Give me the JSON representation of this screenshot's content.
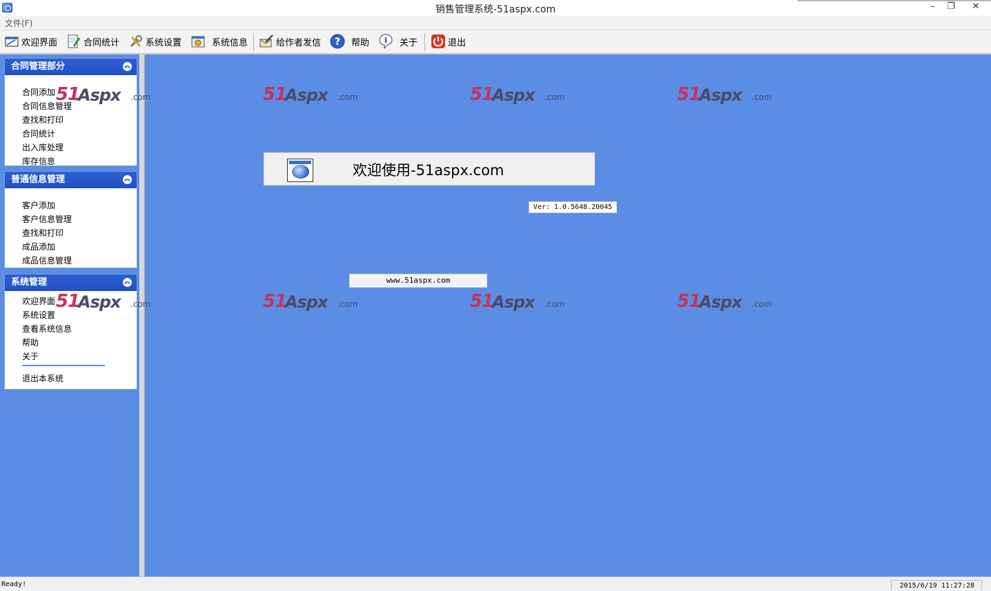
{
  "window": {
    "title": "销售管理系统-51aspx.com",
    "minimize": "–",
    "restore": "❐",
    "close": "✕"
  },
  "menu": {
    "file": "文件(F)"
  },
  "toolbar": {
    "items": [
      {
        "label": "欢迎界面",
        "icon": "welcome-window-icon"
      },
      {
        "label": "合同统计",
        "icon": "notepad-pencil-icon"
      },
      {
        "label": "系统设置",
        "icon": "tools-icon"
      },
      {
        "label": "系统信息",
        "icon": "system-info-icon"
      },
      {
        "label": "给作者发信",
        "icon": "mail-write-icon"
      },
      {
        "label": "帮助",
        "icon": "help-icon"
      },
      {
        "label": "关于",
        "icon": "info-icon"
      },
      {
        "label": "退出",
        "icon": "power-exit-icon"
      }
    ]
  },
  "sidebar": {
    "groups": [
      {
        "title": "合同管理部分",
        "items": [
          "合同添加",
          "合同信息管理",
          "查找和打印",
          "合同统计",
          "出入库处理",
          "库存信息"
        ]
      },
      {
        "title": "普通信息管理",
        "items": [
          "客户添加",
          "客户信息管理",
          "查找和打印",
          "成品添加",
          "成品信息管理"
        ]
      },
      {
        "title": "系统管理",
        "items": [
          "欢迎界面",
          "系统设置",
          "查看系统信息",
          "帮助",
          "关于",
          "退出本系统"
        ]
      }
    ]
  },
  "watermark": {
    "prefix": "51",
    "brand": "Aspx",
    "suffix": ".com"
  },
  "main": {
    "welcome_text": "欢迎使用-51aspx.com",
    "version": "Ver: 1.0.5648.20045",
    "url": "www.51aspx.com"
  },
  "status": {
    "left": "Ready!",
    "right": "2015/6/19 11:27:28"
  },
  "colors": {
    "background": "#5b8de4",
    "group_header": "#2150c6",
    "watermark_red": "#c2355e"
  }
}
